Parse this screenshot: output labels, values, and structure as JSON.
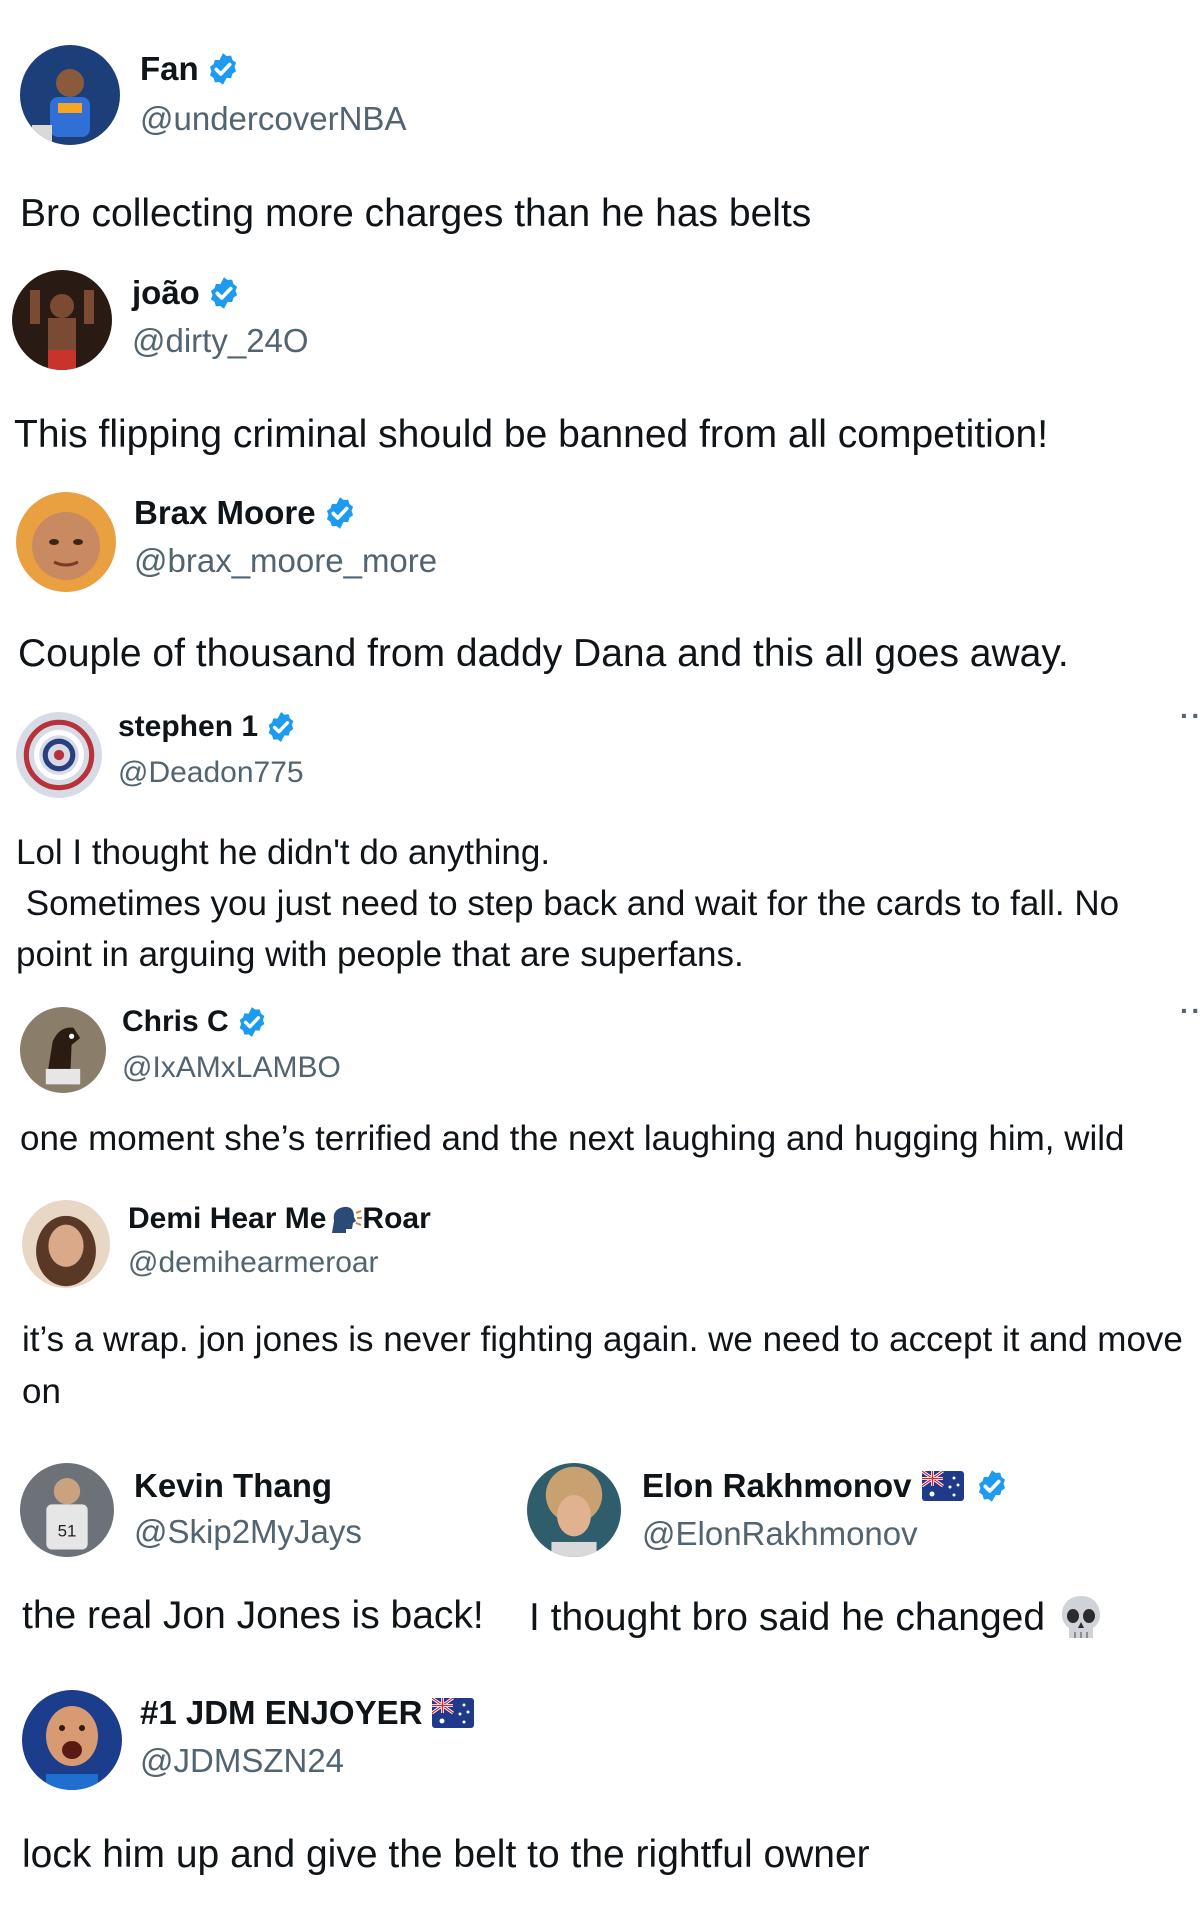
{
  "replies": [
    {
      "name": "Fan",
      "handle": "@undercoverNBA",
      "text": "Bro collecting more charges than he has belts",
      "avatar_icon": "basketball-player-avatar",
      "verified": true
    },
    {
      "name": "joão",
      "handle": "@dirty_24O",
      "text": "This flipping criminal should be banned from all competition!",
      "avatar_icon": "fighter-avatar",
      "verified": true
    },
    {
      "name": "Brax Moore",
      "handle": "@brax_moore_more",
      "text": "Couple of thousand from daddy Dana and this all goes away.",
      "avatar_icon": "bald-man-avatar",
      "verified": true
    },
    {
      "name": "stephen 1",
      "handle": "@Deadon775",
      "text": "Lol I thought he didn't do anything.\n Sometimes you just need to step back and wait for the cards to fall. No point in arguing with people that are superfans.",
      "avatar_icon": "swirl-flag-avatar",
      "verified": true
    },
    {
      "name": "Chris C",
      "handle": "@IxAMxLAMBO",
      "text": "one moment she’s terrified and the next laughing and hugging him, wild",
      "avatar_icon": "horse-avatar",
      "verified": true
    },
    {
      "name": "Demi Hear Me",
      "name_suffix": "Roar",
      "name_emoji": "speaking-head-icon",
      "handle": "@demihearmeroar",
      "text": "it’s a wrap. jon jones is never fighting again. we need to accept it and move on",
      "avatar_icon": "woman-avatar",
      "verified": false
    },
    {
      "name": "Kevin Thang",
      "handle": "@Skip2MyJays",
      "text": "the real Jon Jones is back!",
      "avatar_icon": "baseball-player-avatar",
      "verified": false
    },
    {
      "name": "Elon Rakhmonov",
      "handle": "@ElonRakhmonov",
      "text": "I thought bro said he changed",
      "text_emoji": "skull-icon",
      "avatar_icon": "curly-hair-avatar",
      "verified": true,
      "flag": "australia-flag-icon"
    },
    {
      "name": "#1 JDM ENJOYER",
      "handle": "@JDMSZN24",
      "text": "lock him up and give the belt to the rightful owner",
      "avatar_icon": "shouting-man-avatar",
      "verified": false,
      "flag": "australia-flag-icon"
    }
  ],
  "more_menu": "··",
  "colors": {
    "verified": "#1d9bf0",
    "text": "#0f1419",
    "secondary": "#536471"
  }
}
